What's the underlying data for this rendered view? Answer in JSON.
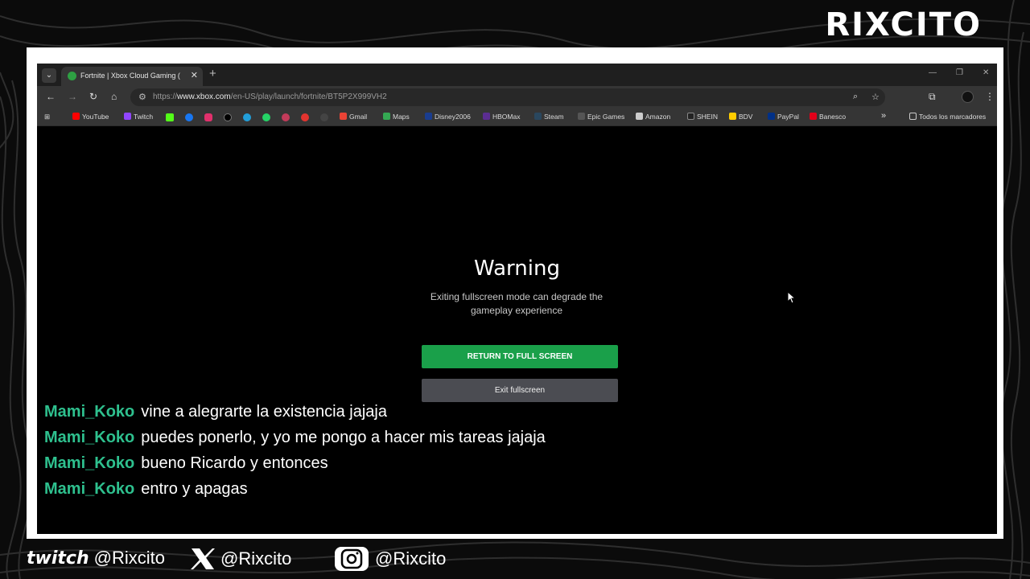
{
  "brand": "RIXCITO",
  "browser": {
    "tab_title": "Fortnite | Xbox Cloud Gaming (",
    "url_prefix": "https://",
    "url_domain": "www.xbox.com",
    "url_path": "/en-US/play/launch/fortnite/BT5P2X999VH2",
    "bookmarks": [
      {
        "label": "YouTube",
        "color": "#ff0000"
      },
      {
        "label": "Twitch",
        "color": "#9146ff"
      },
      {
        "label": "Gmail",
        "color": "#ea4335"
      },
      {
        "label": "Maps",
        "color": "#34a853"
      },
      {
        "label": "Disney2006",
        "color": "#1a3d8f"
      },
      {
        "label": "HBOMax",
        "color": "#5b2d91"
      },
      {
        "label": "Steam",
        "color": "#1b2838"
      },
      {
        "label": "Epic Games",
        "color": "#555555"
      },
      {
        "label": "Amazon",
        "color": "#cccccc"
      },
      {
        "label": "SHEIN",
        "color": "#222222"
      },
      {
        "label": "BDV",
        "color": "#ffcc00"
      },
      {
        "label": "PayPal",
        "color": "#003087"
      },
      {
        "label": "Banesco",
        "color": "#e2001a"
      }
    ],
    "all_bookmarks": "Todos los marcadores",
    "more_bookmarks": "»"
  },
  "page": {
    "title": "Warning",
    "message": "Exiting fullscreen mode can degrade the gameplay experience",
    "return_button": "RETURN TO FULL SCREEN",
    "exit_button": "Exit fullscreen"
  },
  "chat": [
    {
      "user": "Mami_Koko",
      "text": "vine a alegrarte la existencia jajaja"
    },
    {
      "user": "Mami_Koko",
      "text": "puedes ponerlo, y yo me pongo a hacer mis tareas jajaja"
    },
    {
      "user": "Mami_Koko",
      "text": "bueno Ricardo y entonces"
    },
    {
      "user": "Mami_Koko",
      "text": "entro y apagas"
    }
  ],
  "socials": {
    "twitch_handle": "@Rixcito",
    "x_handle": "@Rixcito",
    "instagram_handle": "@Rixcito"
  }
}
